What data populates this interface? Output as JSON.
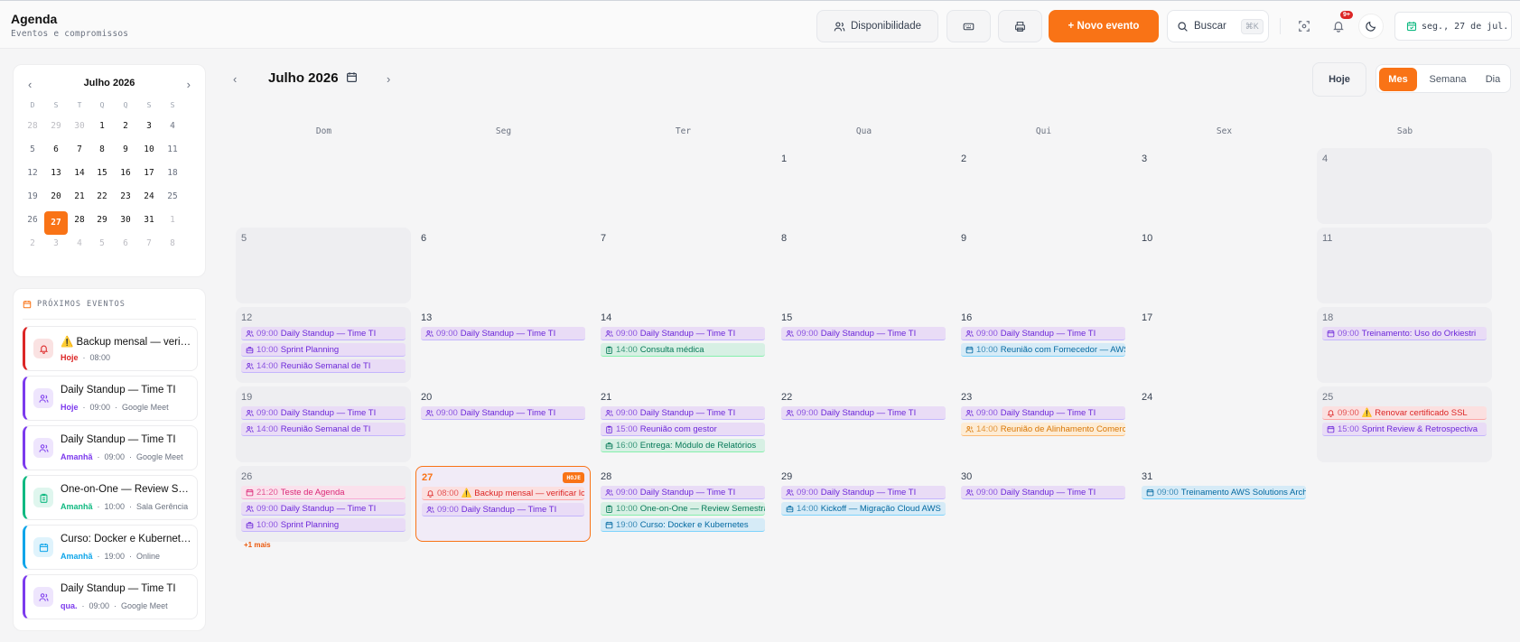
{
  "header": {
    "title": "Agenda",
    "subtitle": "Eventos e compromissos",
    "availability_label": "Disponibilidade",
    "new_event_label": "+ Novo evento",
    "search_label": "Buscar",
    "search_shortcut": "⌘K",
    "notif_badge": "9+",
    "date_chip": "seg., 27 de jul."
  },
  "mini": {
    "title": "Julho 2026",
    "dow": [
      "D",
      "S",
      "T",
      "Q",
      "Q",
      "S",
      "S"
    ],
    "days": [
      [
        "28",
        "29",
        "30",
        "1",
        "2",
        "3",
        "4"
      ],
      [
        "5",
        "6",
        "7",
        "8",
        "9",
        "10",
        "11"
      ],
      [
        "12",
        "13",
        "14",
        "15",
        "16",
        "17",
        "18"
      ],
      [
        "19",
        "20",
        "21",
        "22",
        "23",
        "24",
        "25"
      ],
      [
        "26",
        "27",
        "28",
        "29",
        "30",
        "31",
        "1"
      ],
      [
        "2",
        "3",
        "4",
        "5",
        "6",
        "7",
        "8"
      ]
    ]
  },
  "upcoming": {
    "title": "PRÓXIMOS EVENTOS",
    "items": [
      {
        "name": "⚠️ Backup mensal — verificar logs",
        "when": "Hoje",
        "time": "08:00",
        "place": "",
        "color": "#dc2626",
        "icon": "bell-icon"
      },
      {
        "name": "Daily Standup — Time TI",
        "when": "Hoje",
        "time": "09:00",
        "place": "Google Meet",
        "color": "#7c3aed",
        "icon": "users-icon"
      },
      {
        "name": "Daily Standup — Time TI",
        "when": "Amanhã",
        "time": "09:00",
        "place": "Google Meet",
        "color": "#7c3aed",
        "icon": "users-icon"
      },
      {
        "name": "One-on-One — Review Semestral",
        "when": "Amanhã",
        "time": "10:00",
        "place": "Sala Gerência",
        "color": "#10b981",
        "icon": "clipboard-icon"
      },
      {
        "name": "Curso: Docker e Kubernetes",
        "when": "Amanhã",
        "time": "19:00",
        "place": "Online",
        "color": "#0ea5e9",
        "icon": "calendar-icon"
      },
      {
        "name": "Daily Standup — Time TI",
        "when": "qua.",
        "time": "09:00",
        "place": "Google Meet",
        "color": "#7c3aed",
        "icon": "users-icon"
      }
    ]
  },
  "calendar": {
    "title": "Julho 2026",
    "today_btn": "Hoje",
    "views": [
      "Mes",
      "Semana",
      "Dia"
    ],
    "dow": [
      "Dom",
      "Seg",
      "Ter",
      "Qua",
      "Qui",
      "Sex",
      "Sab"
    ],
    "today_tag": "HOJE",
    "more_label": "+1 mais",
    "weeks": [
      [
        {
          "d": ""
        },
        {
          "d": ""
        },
        {
          "d": ""
        },
        {
          "d": "1"
        },
        {
          "d": "2"
        },
        {
          "d": "3"
        },
        {
          "d": "4",
          "we": true
        }
      ],
      [
        {
          "d": "5",
          "we": true
        },
        {
          "d": "6"
        },
        {
          "d": "7"
        },
        {
          "d": "8"
        },
        {
          "d": "9"
        },
        {
          "d": "10"
        },
        {
          "d": "11",
          "we": true
        }
      ],
      [
        {
          "d": "12",
          "we": true,
          "ev": [
            [
              "09:00",
              "Daily Standup — Time TI",
              "purple",
              "users"
            ],
            [
              "10:00",
              "Sprint Planning",
              "purple",
              "briefcase"
            ],
            [
              "14:00",
              "Reunião Semanal de TI",
              "purple",
              "users"
            ]
          ]
        },
        {
          "d": "13",
          "ev": [
            [
              "09:00",
              "Daily Standup — Time TI",
              "purple",
              "users"
            ]
          ]
        },
        {
          "d": "14",
          "ev": [
            [
              "09:00",
              "Daily Standup — Time TI",
              "purple",
              "users"
            ],
            [
              "14:00",
              "Consulta médica",
              "green",
              "clipboard"
            ]
          ]
        },
        {
          "d": "15",
          "ev": [
            [
              "09:00",
              "Daily Standup — Time TI",
              "purple",
              "users"
            ]
          ]
        },
        {
          "d": "16",
          "ev": [
            [
              "09:00",
              "Daily Standup — Time TI",
              "purple",
              "users"
            ],
            [
              "10:00",
              "Reunião com Fornecedor — AWS",
              "blue",
              "calendar"
            ]
          ]
        },
        {
          "d": "17"
        },
        {
          "d": "18",
          "we": true,
          "ev": [
            [
              "09:00",
              "Treinamento: Uso do Orkiestri",
              "purple",
              "calendar"
            ]
          ]
        }
      ],
      [
        {
          "d": "19",
          "we": true,
          "ev": [
            [
              "09:00",
              "Daily Standup — Time TI",
              "purple",
              "users"
            ],
            [
              "14:00",
              "Reunião Semanal de TI",
              "purple",
              "users"
            ]
          ]
        },
        {
          "d": "20",
          "ev": [
            [
              "09:00",
              "Daily Standup — Time TI",
              "purple",
              "users"
            ]
          ]
        },
        {
          "d": "21",
          "ev": [
            [
              "09:00",
              "Daily Standup — Time TI",
              "purple",
              "users"
            ],
            [
              "15:00",
              "Reunião com gestor",
              "purple",
              "clipboard"
            ],
            [
              "16:00",
              "Entrega: Módulo de Relatórios",
              "green",
              "briefcase"
            ]
          ]
        },
        {
          "d": "22",
          "ev": [
            [
              "09:00",
              "Daily Standup — Time TI",
              "purple",
              "users"
            ]
          ]
        },
        {
          "d": "23",
          "ev": [
            [
              "09:00",
              "Daily Standup — Time TI",
              "purple",
              "users"
            ],
            [
              "14:00",
              "Reunião de Alinhamento Comercial",
              "orange",
              "users"
            ]
          ]
        },
        {
          "d": "24"
        },
        {
          "d": "25",
          "we": true,
          "ev": [
            [
              "09:00",
              "⚠️ Renovar certificado SSL",
              "red",
              "bell"
            ],
            [
              "15:00",
              "Sprint Review & Retrospectiva",
              "purple",
              "calendar"
            ]
          ]
        }
      ],
      [
        {
          "d": "26",
          "we": true,
          "more": true,
          "ev": [
            [
              "21:20",
              "Teste de Agenda",
              "pink",
              "calendar"
            ],
            [
              "09:00",
              "Daily Standup — Time TI",
              "purple",
              "users"
            ],
            [
              "10:00",
              "Sprint Planning",
              "purple",
              "briefcase"
            ]
          ]
        },
        {
          "d": "27",
          "today": true,
          "ev": [
            [
              "08:00",
              "⚠️ Backup mensal — verificar logs",
              "red",
              "bell"
            ],
            [
              "09:00",
              "Daily Standup — Time TI",
              "purple",
              "users"
            ]
          ]
        },
        {
          "d": "28",
          "ev": [
            [
              "09:00",
              "Daily Standup — Time TI",
              "purple",
              "users"
            ],
            [
              "10:00",
              "One-on-One — Review Semestral",
              "green",
              "clipboard"
            ],
            [
              "19:00",
              "Curso: Docker e Kubernetes",
              "blue",
              "calendar"
            ]
          ]
        },
        {
          "d": "29",
          "ev": [
            [
              "09:00",
              "Daily Standup — Time TI",
              "purple",
              "users"
            ],
            [
              "14:00",
              "Kickoff — Migração Cloud AWS",
              "blue",
              "briefcase"
            ]
          ]
        },
        {
          "d": "30",
          "ev": [
            [
              "09:00",
              "Daily Standup — Time TI",
              "purple",
              "users"
            ]
          ]
        },
        {
          "d": "31",
          "ev": [
            [
              "09:00",
              "Treinamento AWS Solutions Architect",
              "blue",
              "calendar"
            ]
          ]
        },
        {
          "d": ""
        }
      ]
    ]
  },
  "colors": {
    "accent": "#f97316",
    "purple": "#7c3aed",
    "green": "#10b981",
    "blue": "#0ea5e9",
    "red": "#dc2626"
  }
}
